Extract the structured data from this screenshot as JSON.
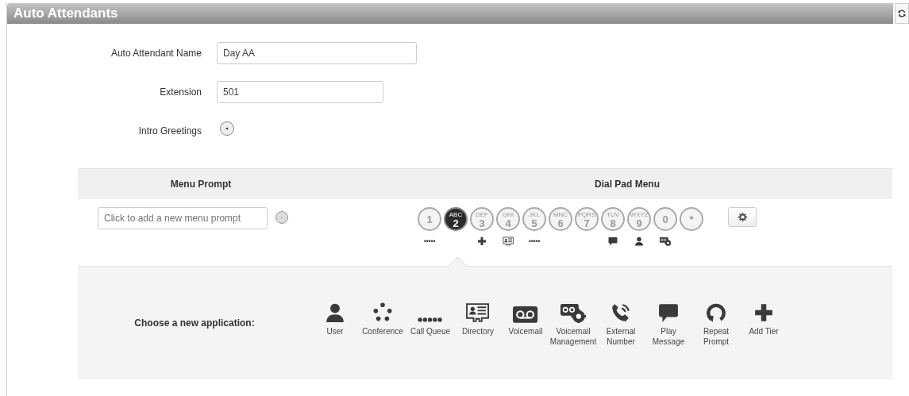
{
  "header": {
    "title": "Auto Attendants"
  },
  "form": {
    "fields": [
      {
        "kind": "text",
        "label": "Auto Attendant Name",
        "value": "Day AA"
      },
      {
        "kind": "text",
        "label": "Extension",
        "value": "501"
      },
      {
        "kind": "audio",
        "label": "Intro Greetings"
      }
    ]
  },
  "menu": {
    "columns": [
      "Menu Prompt",
      "Dial Pad Menu"
    ],
    "prompt": {
      "placeholder": "Click to add a new menu prompt"
    },
    "keys": [
      {
        "digit": "1",
        "selected": false,
        "assigned": {
          "kind": "call-queue"
        }
      },
      {
        "digit": "2",
        "letters": "ABC",
        "selected": true
      },
      {
        "digit": "3",
        "letters": "DEF",
        "selected": false,
        "assigned": {
          "kind": "add-tier"
        }
      },
      {
        "digit": "4",
        "letters": "GHI",
        "selected": false,
        "assigned": {
          "kind": "directory"
        }
      },
      {
        "digit": "5",
        "letters": "JKL",
        "selected": false,
        "assigned": {
          "kind": "call-queue"
        }
      },
      {
        "digit": "6",
        "letters": "MNC",
        "selected": false
      },
      {
        "digit": "7",
        "letters": "PQRS",
        "selected": false
      },
      {
        "digit": "8",
        "letters": "TUV",
        "selected": false,
        "assigned": {
          "kind": "play-message"
        }
      },
      {
        "digit": "9",
        "letters": "WXYZ",
        "selected": false,
        "assigned": {
          "kind": "user"
        }
      },
      {
        "digit": "0",
        "selected": false,
        "assigned": {
          "kind": "voicemail-management"
        }
      },
      {
        "digit": "*",
        "selected": false
      }
    ],
    "chooser": {
      "label": "Choose a new application:",
      "applications": [
        {
          "kind": "user",
          "label": "User"
        },
        {
          "kind": "conference",
          "label": "Conference"
        },
        {
          "kind": "call-queue",
          "label": "Call Queue"
        },
        {
          "kind": "directory",
          "label": "Directory"
        },
        {
          "kind": "voicemail",
          "label": "Voicemail"
        },
        {
          "kind": "voicemail-management",
          "label": "Voicemail Management"
        },
        {
          "kind": "external-number",
          "label": "External Number"
        },
        {
          "kind": "play-message",
          "label": "Play Message"
        },
        {
          "kind": "repeat-prompt",
          "label": "Repeat Prompt"
        },
        {
          "kind": "add-tier",
          "label": "Add Tier"
        }
      ]
    }
  }
}
